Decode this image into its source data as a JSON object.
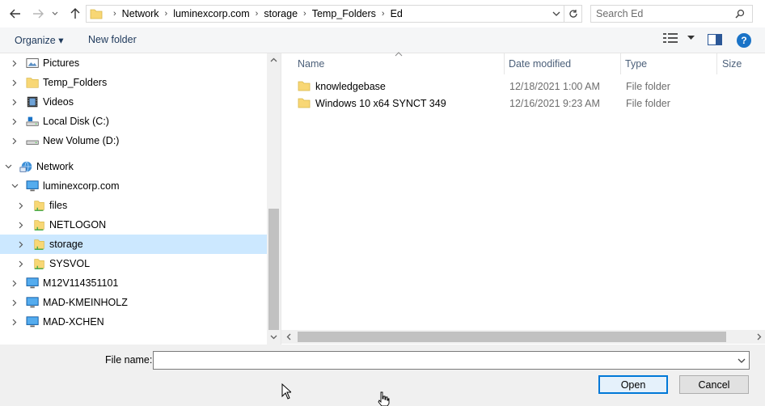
{
  "address": {
    "breadcrumbs": [
      "Network",
      "luminexcorp.com",
      "storage",
      "Temp_Folders",
      "Ed"
    ]
  },
  "search": {
    "placeholder": "Search Ed"
  },
  "toolbar": {
    "organize_label": "Organize ▾",
    "new_folder_label": "New folder",
    "help_label": "?"
  },
  "tree": [
    {
      "label": "Pictures",
      "icon": "pictures-icon",
      "level": 1,
      "expander": "collapsed"
    },
    {
      "label": "Temp_Folders",
      "icon": "folder-icon",
      "level": 1,
      "expander": "collapsed"
    },
    {
      "label": "Videos",
      "icon": "videos-icon",
      "level": 1,
      "expander": "collapsed"
    },
    {
      "label": "Local Disk (C:)",
      "icon": "local-disk-icon",
      "level": 1,
      "expander": "collapsed"
    },
    {
      "label": "New Volume (D:)",
      "icon": "drive-icon",
      "level": 1,
      "expander": "collapsed"
    },
    {
      "label": "Network",
      "icon": "network-icon",
      "level": 0,
      "expander": "expanded"
    },
    {
      "label": "luminexcorp.com",
      "icon": "computer-icon",
      "level": 1,
      "expander": "expanded"
    },
    {
      "label": "files",
      "icon": "shared-folder-icon",
      "level": 2,
      "expander": "collapsed"
    },
    {
      "label": "NETLOGON",
      "icon": "shared-folder-icon",
      "level": 2,
      "expander": "collapsed"
    },
    {
      "label": "storage",
      "icon": "shared-folder-icon",
      "level": 2,
      "expander": "collapsed",
      "selected": true
    },
    {
      "label": "SYSVOL",
      "icon": "shared-folder-icon",
      "level": 2,
      "expander": "collapsed"
    },
    {
      "label": "M12V114351101",
      "icon": "computer-icon",
      "level": 1,
      "expander": "collapsed"
    },
    {
      "label": "MAD-KMEINHOLZ",
      "icon": "computer-icon",
      "level": 1,
      "expander": "collapsed"
    },
    {
      "label": "MAD-XCHEN",
      "icon": "computer-icon",
      "level": 1,
      "expander": "collapsed"
    }
  ],
  "columns": {
    "name": "Name",
    "date": "Date modified",
    "type": "Type",
    "size": "Size"
  },
  "files": [
    {
      "name": "knowledgebase",
      "date": "12/18/2021 1:00 AM",
      "type": "File folder"
    },
    {
      "name": "Windows 10 x64 SYNCT 349",
      "date": "12/16/2021 9:23 AM",
      "type": "File folder"
    }
  ],
  "bottom": {
    "file_name_label": "File name:",
    "file_name_value": "",
    "open_label": "Open",
    "cancel_label": "Cancel"
  },
  "colors": {
    "accent": "#0078d7",
    "selection": "#cce8ff",
    "folder": "#f8d775"
  }
}
